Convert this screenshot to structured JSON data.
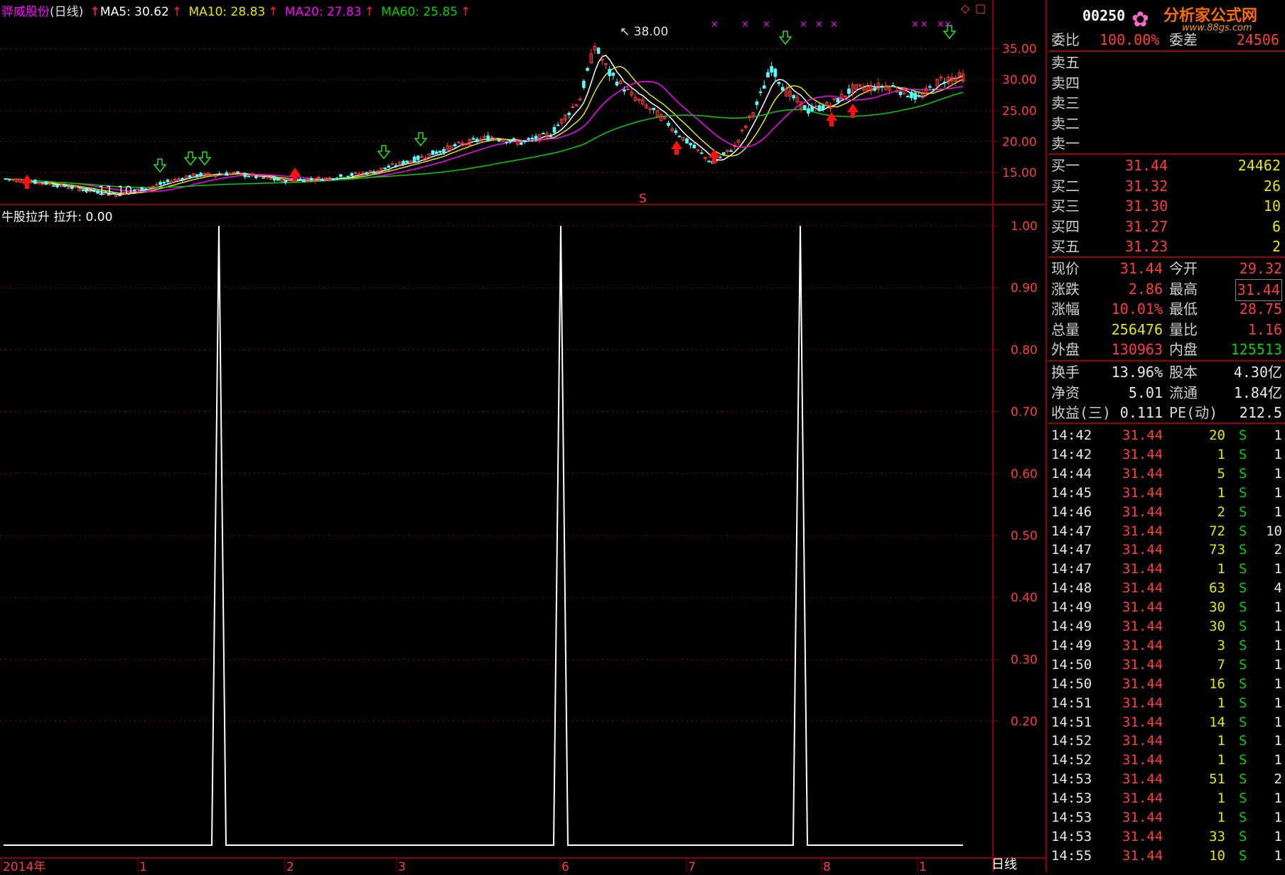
{
  "header": {
    "stock_name": "骅威股份",
    "period": "(日线)",
    "ma5": "MA5: 30.62",
    "ma10": "MA10: 28.83",
    "ma20": "MA20: 27.83",
    "ma60": "MA60: 25.85"
  },
  "indicator": {
    "title": "牛股拉升",
    "value": "拉升: 0.00"
  },
  "price_axis": [
    "35.00",
    "30.00",
    "25.00",
    "20.00",
    "15.00"
  ],
  "indicator_axis": [
    "1.00",
    "0.90",
    "0.80",
    "0.70",
    "0.60",
    "0.50",
    "0.40",
    "0.30",
    "0.20"
  ],
  "date_axis": [
    "2014年",
    "1",
    "2",
    "3",
    "6",
    "7",
    "8",
    "1"
  ],
  "period_tab": "日线",
  "annotations": {
    "high": "38.00",
    "low": "11.10",
    "s_mark": "S"
  },
  "colors": {
    "ma5": "#ffffff",
    "ma10": "#e6e600",
    "ma20": "#ff00ff",
    "ma60": "#00d000",
    "up": "#ff3c3c",
    "down": "#54ffff",
    "grid": "#8b0000"
  },
  "side": {
    "code": "00250",
    "logo_text": "分析家公式网",
    "logo_url": "www.88gs.com",
    "weibi": {
      "label": "委比",
      "value": "100.00%",
      "label2": "委差",
      "value2": "24506"
    },
    "sells": [
      {
        "label": "卖五"
      },
      {
        "label": "卖四"
      },
      {
        "label": "卖三"
      },
      {
        "label": "卖二"
      },
      {
        "label": "卖一"
      }
    ],
    "buys": [
      {
        "label": "买一",
        "price": "31.44",
        "vol": "24462"
      },
      {
        "label": "买二",
        "price": "31.32",
        "vol": "26"
      },
      {
        "label": "买三",
        "price": "31.30",
        "vol": "10"
      },
      {
        "label": "买四",
        "price": "31.27",
        "vol": "6"
      },
      {
        "label": "买五",
        "price": "31.23",
        "vol": "2"
      }
    ],
    "quote": [
      {
        "l1": "现价",
        "v1": "31.44",
        "l2": "今开",
        "v2": "29.32"
      },
      {
        "l1": "涨跌",
        "v1": "2.86",
        "l2": "最高",
        "v2": "31.44"
      },
      {
        "l1": "涨幅",
        "v1": "10.01%",
        "l2": "最低",
        "v2": "28.75"
      },
      {
        "l1": "总量",
        "v1": "256476",
        "l2": "量比",
        "v2": "1.16"
      },
      {
        "l1": "外盘",
        "v1": "130963",
        "l2": "内盘",
        "v2": "125513"
      }
    ],
    "fund": [
      {
        "l1": "换手",
        "v1": "13.96%",
        "l2": "股本",
        "v2": "4.30亿"
      },
      {
        "l1": "净资",
        "v1": "5.01",
        "l2": "流通",
        "v2": "1.84亿"
      },
      {
        "l1": "收益(三)",
        "v1": "0.111",
        "l2": "PE(动)",
        "v2": "212.5"
      }
    ],
    "ticks": [
      {
        "t": "14:42",
        "p": "31.44",
        "v": "20",
        "s": "S",
        "n": "1"
      },
      {
        "t": "14:42",
        "p": "31.44",
        "v": "1",
        "s": "S",
        "n": "1"
      },
      {
        "t": "14:44",
        "p": "31.44",
        "v": "5",
        "s": "S",
        "n": "1"
      },
      {
        "t": "14:45",
        "p": "31.44",
        "v": "1",
        "s": "S",
        "n": "1"
      },
      {
        "t": "14:46",
        "p": "31.44",
        "v": "2",
        "s": "S",
        "n": "1"
      },
      {
        "t": "14:47",
        "p": "31.44",
        "v": "72",
        "s": "S",
        "n": "10"
      },
      {
        "t": "14:47",
        "p": "31.44",
        "v": "73",
        "s": "S",
        "n": "2"
      },
      {
        "t": "14:47",
        "p": "31.44",
        "v": "1",
        "s": "S",
        "n": "1"
      },
      {
        "t": "14:48",
        "p": "31.44",
        "v": "63",
        "s": "S",
        "n": "4"
      },
      {
        "t": "14:49",
        "p": "31.44",
        "v": "30",
        "s": "S",
        "n": "1"
      },
      {
        "t": "14:49",
        "p": "31.44",
        "v": "30",
        "s": "S",
        "n": "1"
      },
      {
        "t": "14:49",
        "p": "31.44",
        "v": "3",
        "s": "S",
        "n": "1"
      },
      {
        "t": "14:50",
        "p": "31.44",
        "v": "7",
        "s": "S",
        "n": "1"
      },
      {
        "t": "14:50",
        "p": "31.44",
        "v": "16",
        "s": "S",
        "n": "1"
      },
      {
        "t": "14:51",
        "p": "31.44",
        "v": "1",
        "s": "S",
        "n": "1"
      },
      {
        "t": "14:51",
        "p": "31.44",
        "v": "14",
        "s": "S",
        "n": "1"
      },
      {
        "t": "14:52",
        "p": "31.44",
        "v": "1",
        "s": "S",
        "n": "1"
      },
      {
        "t": "14:52",
        "p": "31.44",
        "v": "1",
        "s": "S",
        "n": "1"
      },
      {
        "t": "14:53",
        "p": "31.44",
        "v": "51",
        "s": "S",
        "n": "2"
      },
      {
        "t": "14:53",
        "p": "31.44",
        "v": "1",
        "s": "S",
        "n": "1"
      },
      {
        "t": "14:53",
        "p": "31.44",
        "v": "1",
        "s": "S",
        "n": "1"
      },
      {
        "t": "14:53",
        "p": "31.44",
        "v": "33",
        "s": "S",
        "n": "1"
      },
      {
        "t": "14:55",
        "p": "31.44",
        "v": "10",
        "s": "S",
        "n": "1"
      }
    ]
  }
}
